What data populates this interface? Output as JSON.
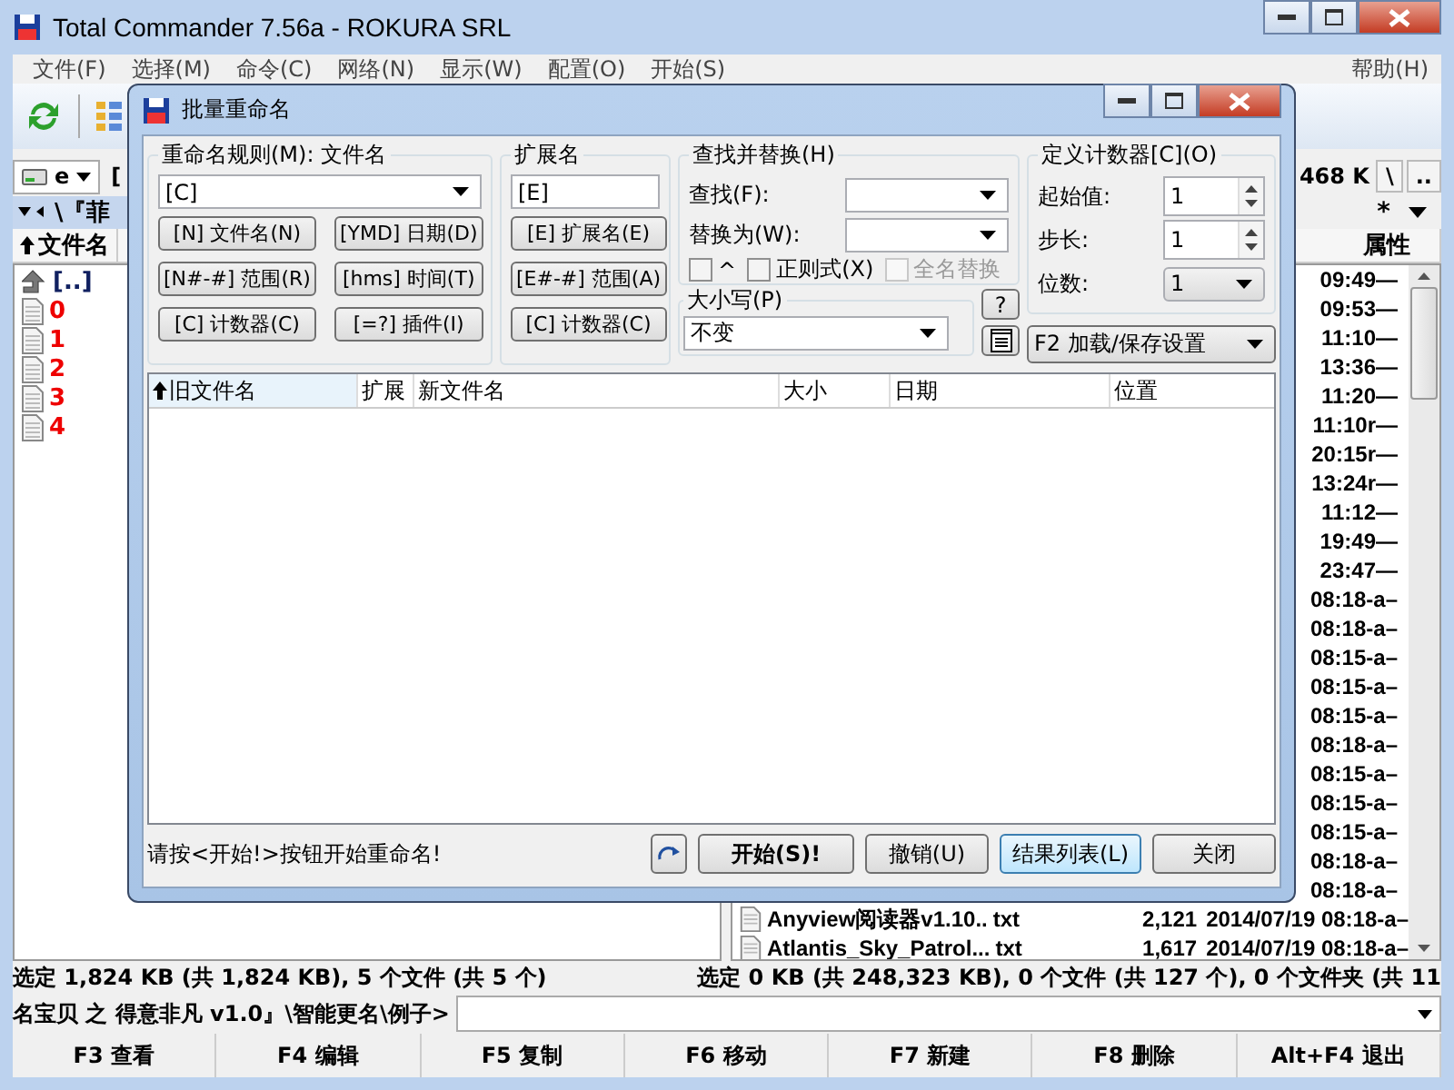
{
  "window": {
    "title": "Total Commander 7.56a - ROKURA SRL"
  },
  "menu": [
    "文件(F)",
    "选择(M)",
    "命令(C)",
    "网络(N)",
    "显示(W)",
    "配置(O)",
    "开始(S)"
  ],
  "help_menu": "帮助(H)",
  "left_panel": {
    "drive": "e",
    "path_start": "[",
    "path": "\\『菲",
    "column": "文件名",
    "files": [
      {
        "name": "[..]",
        "kind": "up"
      },
      {
        "name": "0",
        "kind": "file"
      },
      {
        "name": "1",
        "kind": "file"
      },
      {
        "name": "2",
        "kind": "file"
      },
      {
        "name": "3",
        "kind": "file"
      },
      {
        "name": "4",
        "kind": "file"
      }
    ],
    "status": "选定 1,824 KB (共 1,824 KB), 5 个文件 (共 5 个)"
  },
  "right_panel": {
    "free_space": "468 K",
    "root_button": "\\",
    "parent_button": "..",
    "filter": "*",
    "column": "属性",
    "rows": [
      {
        "kind": "time",
        "text": "09:49—"
      },
      {
        "kind": "time",
        "text": "09:53—"
      },
      {
        "kind": "time",
        "text": "11:10—"
      },
      {
        "kind": "time",
        "text": "13:36—"
      },
      {
        "kind": "time",
        "text": "11:20—"
      },
      {
        "kind": "time",
        "text": "11:10r—"
      },
      {
        "kind": "time",
        "text": "20:15r—"
      },
      {
        "kind": "time",
        "text": "13:24r—"
      },
      {
        "kind": "time",
        "text": "11:12—"
      },
      {
        "kind": "time",
        "text": "19:49—"
      },
      {
        "kind": "time",
        "text": "23:47—"
      },
      {
        "kind": "time",
        "text": "08:18-a–"
      },
      {
        "kind": "time",
        "text": "08:18-a–"
      },
      {
        "kind": "time",
        "text": "08:15-a–"
      },
      {
        "kind": "time",
        "text": "08:15-a–"
      },
      {
        "kind": "time",
        "text": "08:15-a–"
      },
      {
        "kind": "time",
        "text": "08:18-a–"
      },
      {
        "kind": "time",
        "text": "08:15-a–"
      },
      {
        "kind": "time",
        "text": "08:15-a–"
      },
      {
        "kind": "time",
        "text": "08:15-a–"
      },
      {
        "kind": "time",
        "text": "08:18-a–"
      },
      {
        "kind": "time",
        "text": "08:18-a–"
      },
      {
        "kind": "file",
        "name": "Anyview阅读器v1.10..",
        "ext": "txt",
        "size": "2,121",
        "date": "2014/07/19 08:18-a–"
      },
      {
        "kind": "file",
        "name": "Atlantis_Sky_Patrol...",
        "ext": "txt",
        "size": "1,617",
        "date": "2014/07/19 08:18-a–"
      }
    ],
    "status": "选定 0 KB (共 248,323 KB), 0 个文件 (共 127 个), 0 个文件夹 (共 11"
  },
  "command_line": {
    "prompt": "名宝贝 之 得意非凡 v1.0』\\智能更名\\例子>"
  },
  "function_keys": [
    "F3 查看",
    "F4 编辑",
    "F5 复制",
    "F6 移动",
    "F7 新建",
    "F8 删除",
    "Alt+F4 退出"
  ],
  "dialog": {
    "title": "批量重命名",
    "rename_mask": {
      "label": "重命名规则(M): 文件名",
      "value": "[C]",
      "buttons": [
        "[N] 文件名(N)",
        "[YMD] 日期(D)",
        "[N#-#] 范围(R)",
        "[hms] 时间(T)",
        "[C] 计数器(C)",
        "[=?] 插件(I)"
      ]
    },
    "extension": {
      "label": "扩展名",
      "value": "[E]",
      "buttons": [
        "[E] 扩展名(E)",
        "[E#-#] 范围(A)",
        "[C] 计数器(C)"
      ]
    },
    "search_replace": {
      "label": "查找并替换(H)",
      "search_label": "查找(F):",
      "replace_label": "替换为(W):",
      "options": [
        {
          "label": "^",
          "checked": false,
          "disabled": false
        },
        {
          "label": "正则式(X)",
          "checked": false,
          "disabled": false
        },
        {
          "label": "全名替换",
          "checked": false,
          "disabled": true
        }
      ]
    },
    "case": {
      "label": "大小写(P)",
      "value": "不变"
    },
    "help_button": "?",
    "counter": {
      "label": "定义计数器[C](O)",
      "start_label": "起始值:",
      "start": "1",
      "step_label": "步长:",
      "step": "1",
      "digits_label": "位数:",
      "digits": "1"
    },
    "settings_button": "F2 加载/保存设置",
    "columns": [
      {
        "label": "旧文件名",
        "sorted": true
      },
      {
        "label": "扩展",
        "sorted": false
      },
      {
        "label": "新文件名",
        "sorted": false
      },
      {
        "label": "大小",
        "sorted": false
      },
      {
        "label": "日期",
        "sorted": false
      },
      {
        "label": "位置",
        "sorted": false
      }
    ],
    "status": "请按<开始!>按钮开始重命名!",
    "buttons": [
      {
        "label": "开始(S)!",
        "kind": "start"
      },
      {
        "label": "撤销(U)",
        "kind": "normal"
      },
      {
        "label": "结果列表(L)",
        "kind": "focused"
      },
      {
        "label": "关闭",
        "kind": "normal"
      }
    ]
  }
}
